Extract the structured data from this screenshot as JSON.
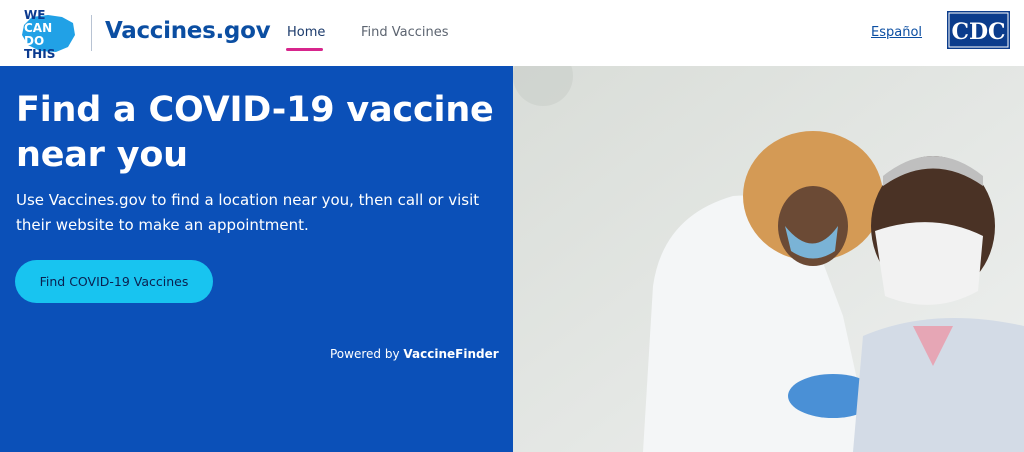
{
  "header": {
    "logo_text": [
      "WE",
      "CAN",
      "DO",
      "THIS"
    ],
    "site_name": "Vaccines.gov",
    "nav": [
      {
        "label": "Home",
        "active": true
      },
      {
        "label": "Find Vaccines",
        "active": false
      }
    ],
    "language_link": "Español",
    "agency_logo": "CDC"
  },
  "hero": {
    "title": "Find a COVID-19 vaccine near you",
    "subtitle": "Use Vaccines.gov to find a location near you, then call or visit their website to make an appointment.",
    "cta_label": "Find COVID-19 Vaccines",
    "powered_prefix": "Powered by",
    "powered_brand": "VaccineFinder"
  },
  "colors": {
    "brand_blue": "#0b50b8",
    "site_name_blue": "#0b4ea2",
    "cta_cyan": "#18c4f0",
    "nav_active_underline": "#d7258c"
  }
}
